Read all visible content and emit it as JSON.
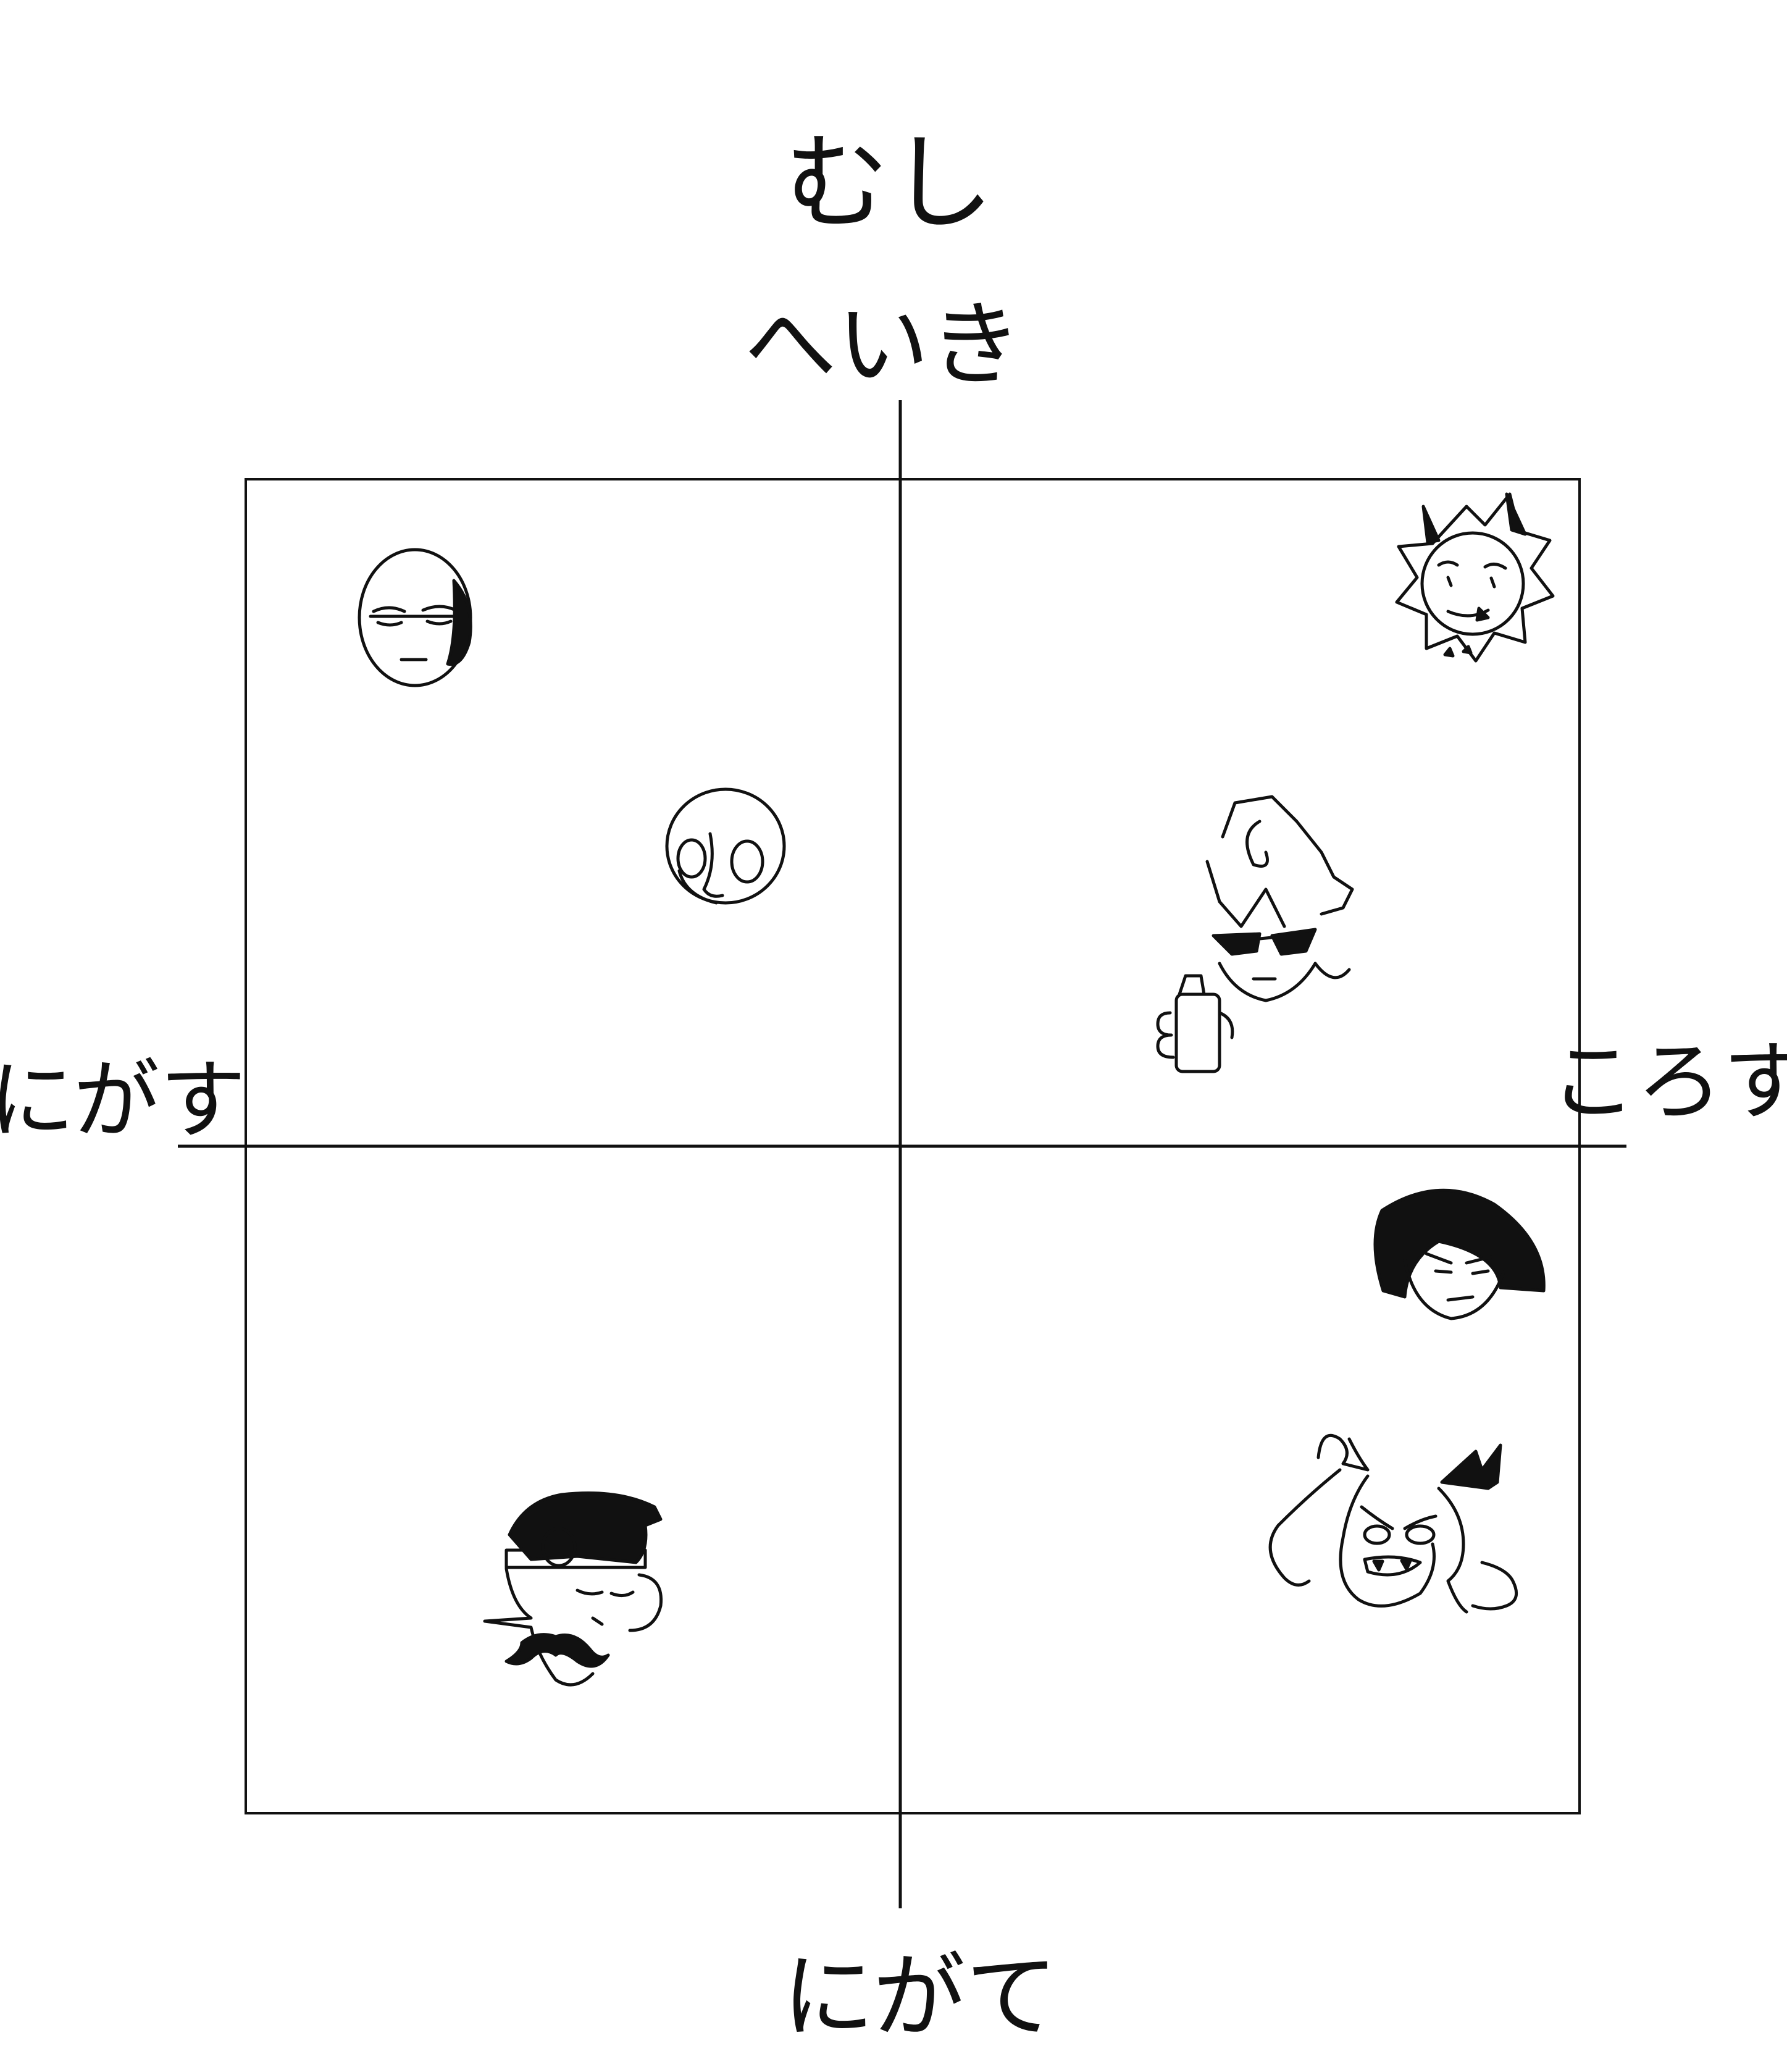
{
  "title": "むし",
  "axes": {
    "top": "へいき",
    "bottom": "にがて",
    "left": "にがす",
    "right": "ころす"
  },
  "colors": {
    "ink": "#111111",
    "background": "#ffffff"
  }
}
